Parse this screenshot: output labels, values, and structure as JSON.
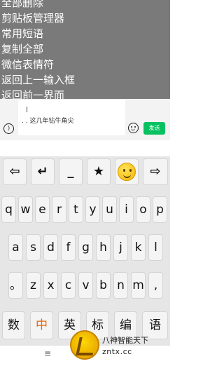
{
  "menu": {
    "items": [
      "全部删除",
      "剪贴板管理器",
      "常用短语",
      "复制全部",
      "微信表情符",
      "返回上一输入框",
      "返回前一界面"
    ]
  },
  "chat": {
    "draft_text": ". . 这几年钻牛角尖",
    "send_label": "发送",
    "voice_icon": "voice-icon",
    "emoji_icon": "emoji-icon"
  },
  "keyboard": {
    "function_row": [
      "⇦",
      "↵",
      "_",
      "★",
      "smiley-emoji",
      "⇨"
    ],
    "row_qwerty": [
      "q",
      "w",
      "e",
      "r",
      "t",
      "y",
      "u",
      "i",
      "o",
      "p"
    ],
    "row_asdf": [
      "a",
      "s",
      "d",
      "f",
      "g",
      "h",
      "j",
      "k",
      "l"
    ],
    "row_zxcv": [
      "。",
      "z",
      "x",
      "c",
      "v",
      "b",
      "n",
      "m",
      ","
    ],
    "mode_row": [
      "数",
      "中",
      "英",
      "标",
      "编",
      "语"
    ],
    "active_mode": "中"
  },
  "bottom": {
    "menu_icon": "≡"
  },
  "watermark": {
    "line1": "八神智能天下",
    "line2": "zntx.cc"
  },
  "colors": {
    "menu_bg": "#7a7a7a",
    "send_green": "#07c160",
    "active_orange": "#e8690c"
  }
}
